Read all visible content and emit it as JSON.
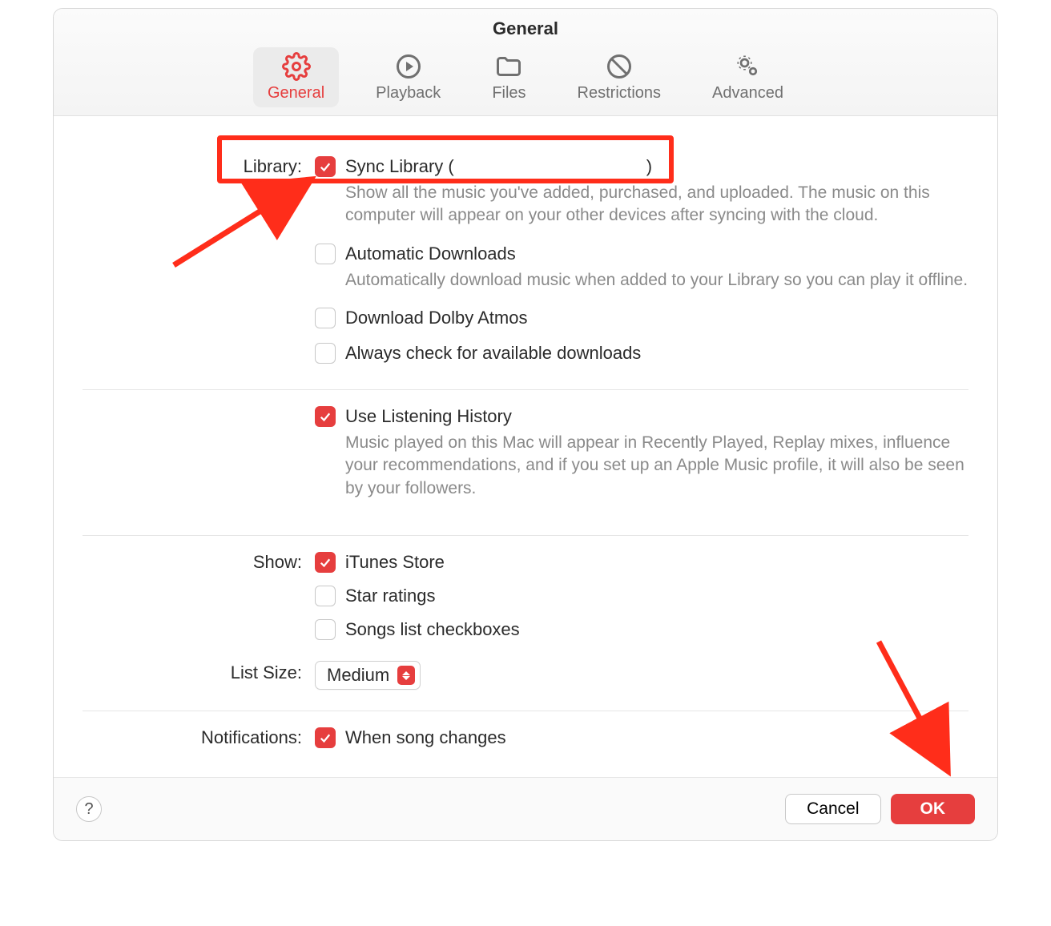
{
  "window": {
    "title": "General"
  },
  "tabs": [
    {
      "id": "general",
      "label": "General",
      "active": true
    },
    {
      "id": "playback",
      "label": "Playback",
      "active": false
    },
    {
      "id": "files",
      "label": "Files",
      "active": false
    },
    {
      "id": "restrictions",
      "label": "Restrictions",
      "active": false
    },
    {
      "id": "advanced",
      "label": "Advanced",
      "active": false
    }
  ],
  "labels": {
    "library": "Library:",
    "show": "Show:",
    "list_size": "List Size:",
    "notifications": "Notifications:"
  },
  "library": {
    "sync": {
      "checked": true,
      "label_prefix": "Sync Library (",
      "label_suffix": ")",
      "redacted": true,
      "desc": "Show all the music you've added, purchased, and uploaded. The music on this computer will appear on your other devices after syncing with the cloud."
    },
    "auto_downloads": {
      "checked": false,
      "label": "Automatic Downloads",
      "desc": "Automatically download music when added to your Library so you can play it offline."
    },
    "dolby": {
      "checked": false,
      "label": "Download Dolby Atmos"
    },
    "check_downloads": {
      "checked": false,
      "label": "Always check for available downloads"
    }
  },
  "listening": {
    "use_history": {
      "checked": true,
      "label": "Use Listening History",
      "desc": "Music played on this Mac will appear in Recently Played, Replay mixes, influence your recommendations, and if you set up an Apple Music profile, it will also be seen by your followers."
    }
  },
  "show": {
    "itunes_store": {
      "checked": true,
      "label": "iTunes Store"
    },
    "star_ratings": {
      "checked": false,
      "label": "Star ratings"
    },
    "songs_checkboxes": {
      "checked": false,
      "label": "Songs list checkboxes"
    }
  },
  "list_size": {
    "value": "Medium"
  },
  "notifications": {
    "song_changes": {
      "checked": true,
      "label": "When song changes"
    }
  },
  "footer": {
    "help": "?",
    "cancel": "Cancel",
    "ok": "OK"
  },
  "colors": {
    "accent": "#e63e3e",
    "annotation": "#ff2d1a"
  }
}
